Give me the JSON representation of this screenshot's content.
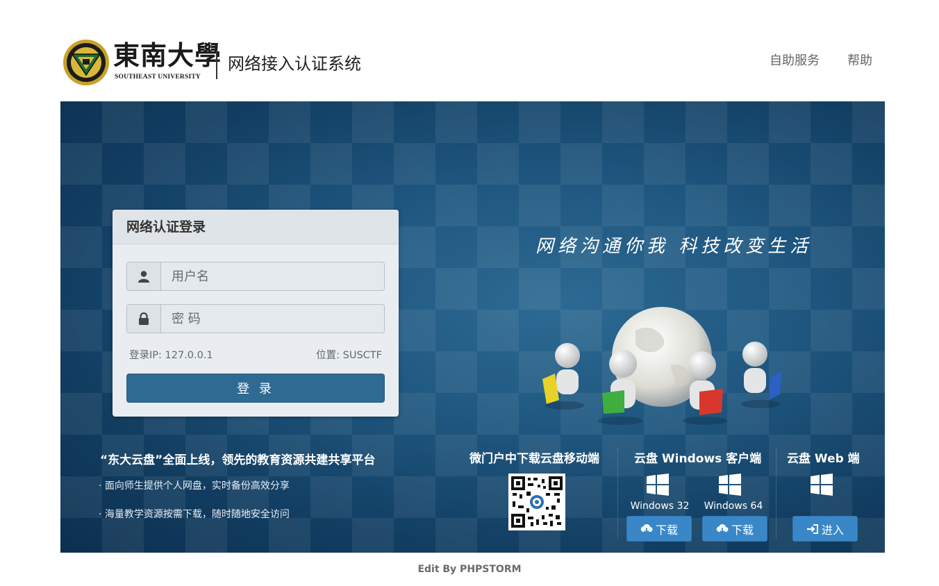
{
  "header": {
    "logo_cn": "東南大學",
    "logo_en": "SOUTHEAST UNIVERSITY",
    "system_title": "网络接入认证系统",
    "nav": [
      "自助服务",
      "帮助"
    ]
  },
  "banner": {
    "slogan": "网络沟通你我  科技改变生活"
  },
  "login": {
    "title": "网络认证登录",
    "username_placeholder": "用户名",
    "password_placeholder": "密 码",
    "ip_label": "登录IP: 127.0.0.1",
    "location_label": "位置: SUSCTF",
    "submit_label": "登 录"
  },
  "promo": {
    "title": "“东大云盘”全面上线，领先的教育资源共建共享平台",
    "lines": [
      "· 面向师生提供个人网盘，实时备份高效分享",
      "· 海量教学资源按需下载，随时随地安全访问"
    ]
  },
  "downloads": {
    "mobile_title": "微门户中下载云盘移动端",
    "windows_title": "云盘 Windows 客户端",
    "web_title": "云盘 Web 端",
    "win32_label": "Windows 32",
    "win64_label": "Windows 64",
    "download_label": "下载",
    "enter_label": "进入"
  },
  "footer": {
    "text": "Edit By PHPSTORM"
  },
  "colors": {
    "login_button": "#2f6a93",
    "download_button": "#3a87c8",
    "banner_bg": "#1f5780"
  }
}
